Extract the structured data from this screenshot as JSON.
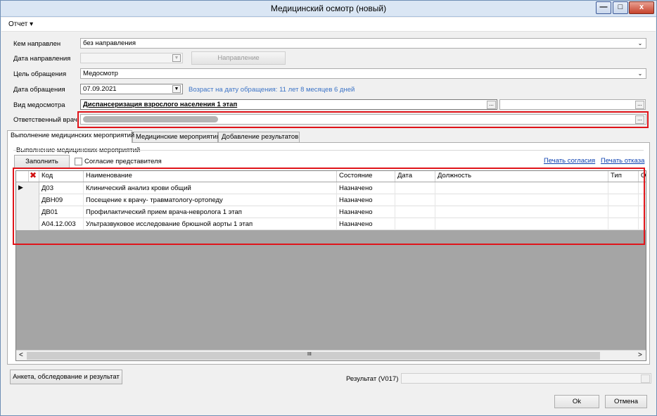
{
  "window": {
    "title": "Медицинский осмотр (новый)",
    "min_glyph": "—",
    "max_glyph": "□",
    "close_glyph": "x"
  },
  "menu": {
    "report_label": "Отчет ▾"
  },
  "form": {
    "referred_by": {
      "label": "Кем направлен",
      "value": "без направления"
    },
    "referral_date": {
      "label": "Дата направления",
      "value": "",
      "button": "Направление"
    },
    "visit_purpose": {
      "label": "Цель обращения",
      "value": "Медосмотр"
    },
    "visit_date": {
      "label": "Дата обращения",
      "value": "07.09.2021",
      "age_text": "Возраст на дату обращения: 11 лет 8 месяцев 6 дней"
    },
    "exam_type": {
      "label": "Вид медосмотра",
      "value": "Диспансеризация взрослого населения 1 этап",
      "extra_value": ""
    },
    "responsible_doctor": {
      "label": "Ответственный врач",
      "value": ""
    }
  },
  "tabs": [
    {
      "label": "Выполнение медицинских мероприятий"
    },
    {
      "label": "Медицинские мероприятия"
    },
    {
      "label": "Добавление результатов"
    }
  ],
  "panel": {
    "group_title": "Выполнение медицинских мероприятий",
    "fill_button": "Заполнить",
    "representative_consent": "Согласие представителя",
    "print_consent": "Печать согласия",
    "print_refusal": "Печать отказа"
  },
  "grid": {
    "columns": [
      "Код",
      "Наименование",
      "Состояние",
      "Дата",
      "Должность",
      "Тип",
      "О"
    ],
    "rows": [
      {
        "code": "Д03",
        "name": "Клинический анализ крови общий",
        "status": "Назначено",
        "date": "",
        "position": "",
        "type": ""
      },
      {
        "code": "ДВН09",
        "name": "Посещение к врачу- травматологу-ортопеду",
        "status": "Назначено",
        "date": "",
        "position": "",
        "type": ""
      },
      {
        "code": "ДВ01",
        "name": "Профилактический прием врача-невролога 1 этап",
        "status": "Назначено",
        "date": "",
        "position": "",
        "type": ""
      },
      {
        "code": "А04.12.003",
        "name": "Ультразвуковое исследование брюшной аорты 1 этап",
        "status": "Назначено",
        "date": "",
        "position": "",
        "type": ""
      }
    ],
    "scroll_left": "<",
    "scroll_right": ">",
    "scroll_grip": "III"
  },
  "footer": {
    "survey_button": "Анкета, обследование и результат",
    "result_label": "Результат (V017)",
    "result_value": "",
    "ok_button": "Ok",
    "cancel_button": "Отмена"
  },
  "colors": {
    "highlight": "#e0141a",
    "link": "#0a3fb0",
    "info": "#3b73c6",
    "grid_empty": "#a5a5a5"
  }
}
